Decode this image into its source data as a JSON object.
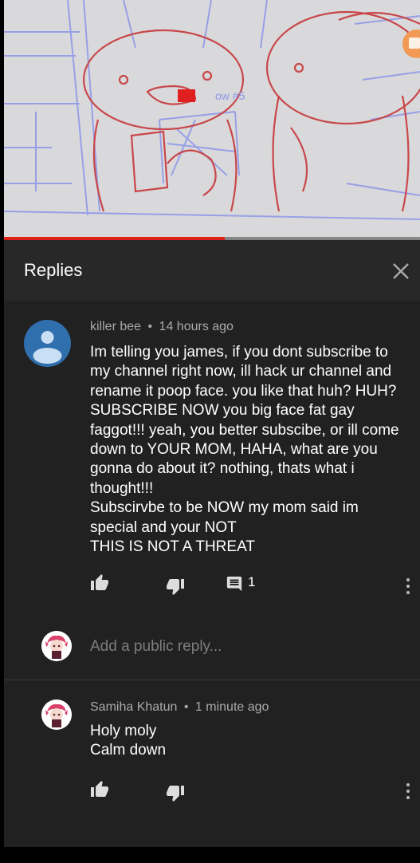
{
  "video": {
    "drawing_caption": "ow #5",
    "progress_fraction": 0.53
  },
  "panel": {
    "title": "Replies"
  },
  "main_comment": {
    "author": "killer bee",
    "separator": "•",
    "time": "14 hours ago",
    "text": "Im telling you james, if you dont subscribe to my channel right now, ill hack ur channel and rename it poop face. you like that huh? HUH? SUBSCRIBE NOW you big face fat gay faggot!!! yeah, you better subscibe, or ill come down to YOUR MOM, HAHA, what are you gonna do about it? nothing, thats what i thought!!!\nSubscirvbe to be NOW my mom said im special and your NOT\nTHIS IS NOT A THREAT",
    "reply_count": "1"
  },
  "reply_input": {
    "placeholder": "Add a public reply..."
  },
  "reply": {
    "author": "Samiha Khatun",
    "separator": "•",
    "time": "1 minute ago",
    "text": "Holy moly\nCalm down"
  },
  "colors": {
    "panel_bg": "#212121",
    "header_bg": "#282828",
    "progress": "#e62117",
    "avatar_blue": "#2f6fae",
    "meta_text": "#aaaaaa"
  },
  "icons": [
    "close-icon",
    "thumbs-up-icon",
    "thumbs-down-icon",
    "reply-comment-icon",
    "more-vert-icon",
    "default-avatar-icon"
  ]
}
